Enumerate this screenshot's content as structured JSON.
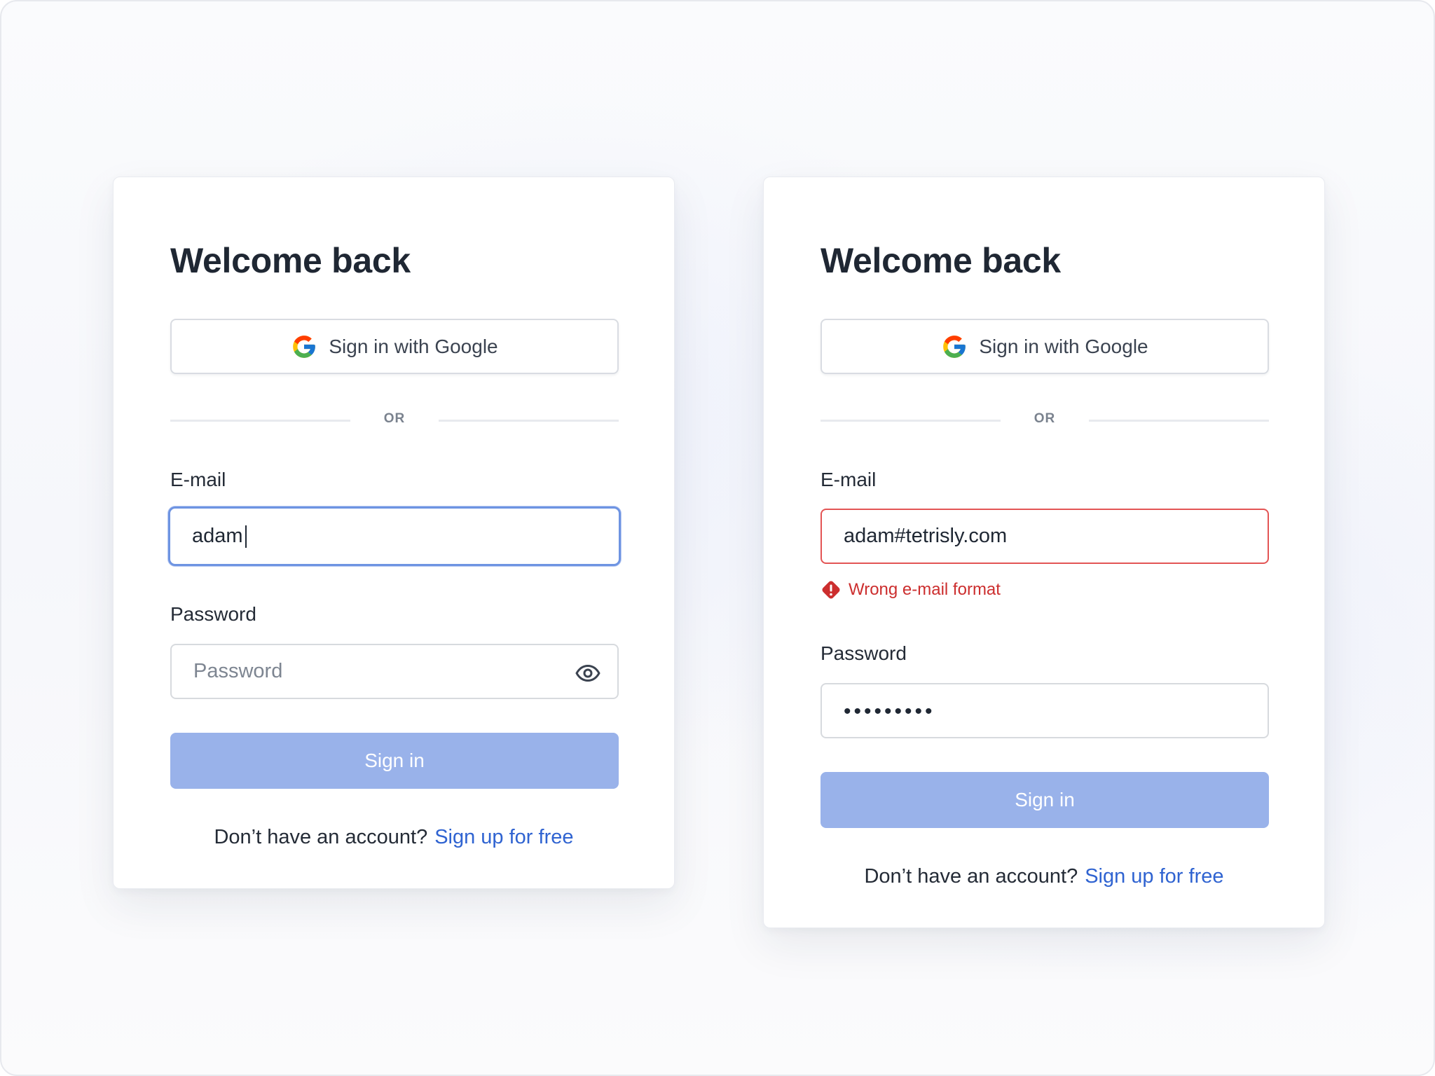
{
  "cards": {
    "left": {
      "title": "Welcome back",
      "google_button": "Sign in with Google",
      "divider": "OR",
      "email_label": "E-mail",
      "email_value": "adam",
      "password_label": "Password",
      "password_placeholder": "Password",
      "signin_button": "Sign in",
      "footer_text": "Don’t have an account?",
      "signup_link": "Sign up for free"
    },
    "right": {
      "title": "Welcome back",
      "google_button": "Sign in with Google",
      "divider": "OR",
      "email_label": "E-mail",
      "email_value": "adam#tetrisly.com",
      "error_message": "Wrong e-mail format",
      "password_label": "Password",
      "password_value": "•••••••••",
      "signin_button": "Sign in",
      "footer_text": "Don’t have an account?",
      "signup_link": "Sign up for free"
    }
  },
  "icons": {
    "google": "google-icon",
    "eye": "eye-icon",
    "warning": "warning-icon"
  },
  "colors": {
    "accent": "#6e94e2",
    "button_disabled": "#99b2ea",
    "link": "#2f63d1",
    "error": "#cc2e2e",
    "error_border": "#e35454",
    "text": "#1f2733"
  }
}
